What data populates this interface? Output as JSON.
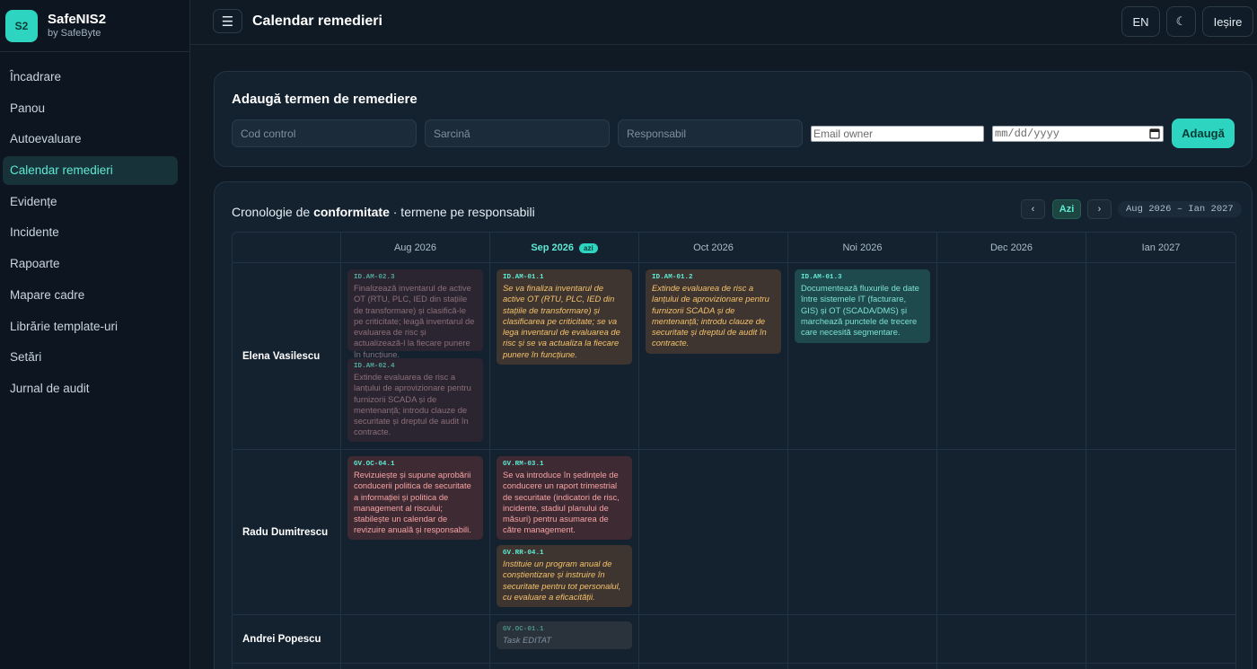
{
  "brand": {
    "logo": "S2",
    "name": "SafeNIS2",
    "sub": "by SafeByte"
  },
  "sidebar": {
    "items": [
      {
        "label": "Încadrare",
        "active": false
      },
      {
        "label": "Panou",
        "active": false
      },
      {
        "label": "Autoevaluare",
        "active": false
      },
      {
        "label": "Calendar remedieri",
        "active": true
      },
      {
        "label": "Evidențe",
        "active": false
      },
      {
        "label": "Incidente",
        "active": false
      },
      {
        "label": "Rapoarte",
        "active": false
      },
      {
        "label": "Mapare cadre",
        "active": false
      },
      {
        "label": "Librărie template-uri",
        "active": false
      },
      {
        "label": "Setări",
        "active": false
      },
      {
        "label": "Jurnal de audit",
        "active": false
      }
    ]
  },
  "header": {
    "menu_icon": "☰",
    "title": "Calendar remedieri",
    "lang_label": "EN",
    "theme_icon": "☾",
    "logout_label": "Ieșire"
  },
  "add_form": {
    "title": "Adaugă termen de remediere",
    "code_placeholder": "Cod control",
    "task_placeholder": "Sarcină",
    "owner_placeholder": "Responsabil",
    "email_placeholder": "Email owner",
    "date_placeholder": "mm/dd/yyyy",
    "submit_label": "Adaugă"
  },
  "timeline": {
    "title_prefix": "Cronologie de ",
    "title_bold": "conformitate",
    "title_suffix": " · termene pe responsabili",
    "prev_label": "‹",
    "today_label": "Azi",
    "next_label": "›",
    "range_label": "Aug 2026 – Ian 2027",
    "current_badge": "azi",
    "months": [
      "Aug 2026",
      "Sep 2026",
      "Oct 2026",
      "Noi 2026",
      "Dec 2026",
      "Ian 2027"
    ],
    "rows": [
      {
        "owner": "Elena Vasilescu",
        "tasks": [
          {
            "code": "ID.AM-02.3",
            "text": "Finalizează inventarul de active OT (RTU, PLC, IED din stațiile de transformare) și clasifică-le pe criticitate; leagă inventarul de evaluarea de risc și actualizează-l la fiecare punere în funcțiune."
          },
          {
            "code": "ID.AM-02.4",
            "text": "Extinde evaluarea de risc a lanțului de aprovizionare pentru furnizorii SCADA și de mentenanță; introdu clauze de securitate și dreptul de audit în contracte."
          },
          {
            "code": "ID.AM-01.1",
            "text": "Se va finaliza inventarul de active OT (RTU, PLC, IED din stațiile de transformare) și clasificarea pe criticitate; se va lega inventarul de evaluarea de risc și se va actualiza la fiecare punere în funcțiune."
          },
          {
            "code": "ID.AM-01.2",
            "text": "Extinde evaluarea de risc a lanțului de aprovizionare pentru furnizorii SCADA și de mentenanță; introdu clauze de securitate și dreptul de audit în contracte."
          },
          {
            "code": "ID.AM-01.3",
            "text": "Documentează fluxurile de date între sistemele IT (facturare, GIS) și OT (SCADA/DMS) și marchează punctele de trecere care necesită segmentare."
          }
        ]
      },
      {
        "owner": "Radu Dumitrescu",
        "tasks": [
          {
            "code": "GV.OC-04.1",
            "text": "Revizuiește și supune aprobării conducerii politica de securitate a informației și politica de management al riscului; stabilește un calendar de revizuire anuală și responsabili."
          },
          {
            "code": "GV.RM-03.1",
            "text": "Se va introduce în ședințele de conducere un raport trimestrial de securitate (indicatori de risc, incidente, stadiul planului de măsuri) pentru asumarea de către management."
          },
          {
            "code": "GV.RR-04.1",
            "text": "Instituie un program anual de conștientizare și instruire în securitate pentru tot personalul, cu evaluare a eficacității."
          }
        ]
      },
      {
        "owner": "Andrei Popescu",
        "tasks": [
          {
            "code": "GV.OC-01.1",
            "text": "Task EDITAT"
          }
        ]
      }
    ]
  },
  "colors": {
    "accent": "#2dd4bf",
    "background": "#0f1a24",
    "card": "#142230"
  }
}
